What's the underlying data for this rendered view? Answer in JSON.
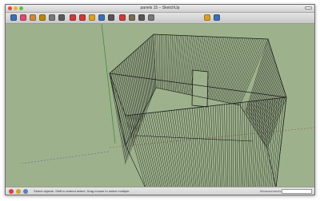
{
  "window": {
    "title": "panels 15 – SketchUp"
  },
  "toolbar": {
    "tools": [
      {
        "name": "select-tool-icon",
        "color": "#3d6fb0"
      },
      {
        "name": "eraser-tool-icon",
        "color": "#d84d6f"
      },
      {
        "name": "paint-bucket-tool-icon",
        "color": "#c98a3a"
      },
      {
        "name": "line-tool-icon",
        "color": "#b8860b"
      },
      {
        "name": "rectangle-tool-icon",
        "color": "#777777"
      },
      {
        "name": "arc-tool-icon",
        "color": "#5a5a5a"
      },
      {
        "name": "push-pull-tool-icon",
        "color": "#cc3a3a"
      },
      {
        "name": "move-tool-icon",
        "color": "#cc3a3a"
      },
      {
        "name": "rotate-tool-icon",
        "color": "#d9a022"
      },
      {
        "name": "offset-tool-icon",
        "color": "#3d6fb0"
      },
      {
        "name": "tape-measure-tool-icon",
        "color": "#555555"
      },
      {
        "name": "orbit-tool-icon",
        "color": "#cc3a3a"
      },
      {
        "name": "pan-tool-icon",
        "color": "#7a6a50"
      },
      {
        "name": "zoom-tool-icon",
        "color": "#555555"
      },
      {
        "name": "zoom-extents-tool-icon",
        "color": "#777777"
      },
      {
        "name": "components-icon",
        "color": "#d9a022"
      },
      {
        "name": "model-info-icon",
        "color": "#3d6fb0"
      }
    ]
  },
  "statusbar": {
    "hint": "Select objects. Shift to extend select. Drag mouse to select multiple.",
    "measurements_label": "Measurements"
  },
  "colors": {
    "viewport_bg": "#9db28c",
    "model_lines": "#1a1a1a",
    "close_button": "#e2463f",
    "minimize_button": "#e9b22f",
    "zoom_button": "#5fbf3f"
  }
}
